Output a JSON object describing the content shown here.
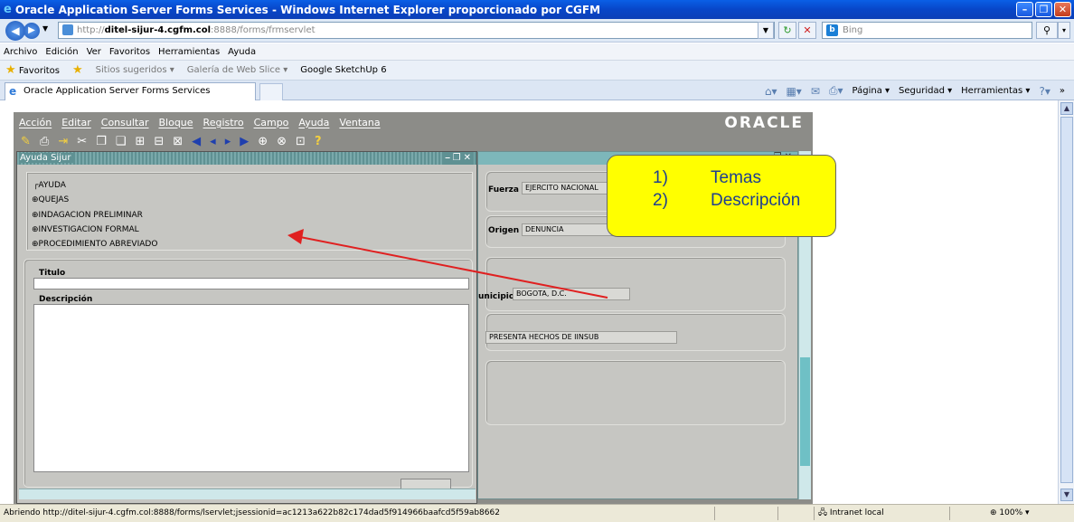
{
  "window": {
    "title": "Oracle Application Server Forms Services - Windows Internet Explorer proporcionado por CGFM"
  },
  "address": {
    "url_prefix": "http://",
    "url_host": "ditel-sijur-4.cgfm.col",
    "url_rest": ":8888/forms/frmservlet",
    "search_placeholder": "Bing"
  },
  "browser_menu": [
    "Archivo",
    "Edición",
    "Ver",
    "Favoritos",
    "Herramientas",
    "Ayuda"
  ],
  "favorites": {
    "label": "Favoritos",
    "items": [
      "Sitios sugeridos ▾",
      "Galería de Web Slice ▾",
      "Google SketchUp 6"
    ]
  },
  "tab": {
    "label": "Oracle Application Server Forms Services"
  },
  "command_bar": [
    "Página ▾",
    "Seguridad ▾",
    "Herramientas ▾"
  ],
  "forms_menu": [
    "Acción",
    "Editar",
    "Consultar",
    "Bloque",
    "Registro",
    "Campo",
    "Ayuda",
    "Ventana"
  ],
  "forms_brand": "ORACLE",
  "dialog": {
    "title": "Ayuda Sijur",
    "tree_root": "AYUDA",
    "tree_items": [
      "QUEJAS",
      "INDAGACION PRELIMINAR",
      "INVESTIGACION FORMAL",
      "PROCEDIMIENTO ABREVIADO"
    ],
    "titulo_label": "Titulo",
    "descripcion_label": "Descripción"
  },
  "background_form": {
    "fuerza_label": "Fuerza",
    "fuerza_value": "EJERCITO NACIONAL",
    "origen_label": "Origen",
    "origen_value": "DENUNCIA",
    "municipio_label": "unicipio",
    "municipio_value": "BOGOTA, D.C.",
    "hechos_value": "PRESENTA HECHOS DE IINSUB"
  },
  "callout": {
    "items": [
      {
        "num": "1)",
        "text": "Temas"
      },
      {
        "num": "2)",
        "text": "Descripción"
      }
    ]
  },
  "status": {
    "text": "Abriendo http://ditel-sijur-4.cgfm.col:8888/forms/lservlet;jsessionid=ac1213a622b82c174dad5f914966baafcd5f59ab8662",
    "zone": "Intranet local",
    "zoom": "100%"
  },
  "colors": {
    "titlebar": "#0846c8",
    "applet_bg": "#8c8c88",
    "callout": "#ffff00",
    "arrow": "#e02020"
  }
}
